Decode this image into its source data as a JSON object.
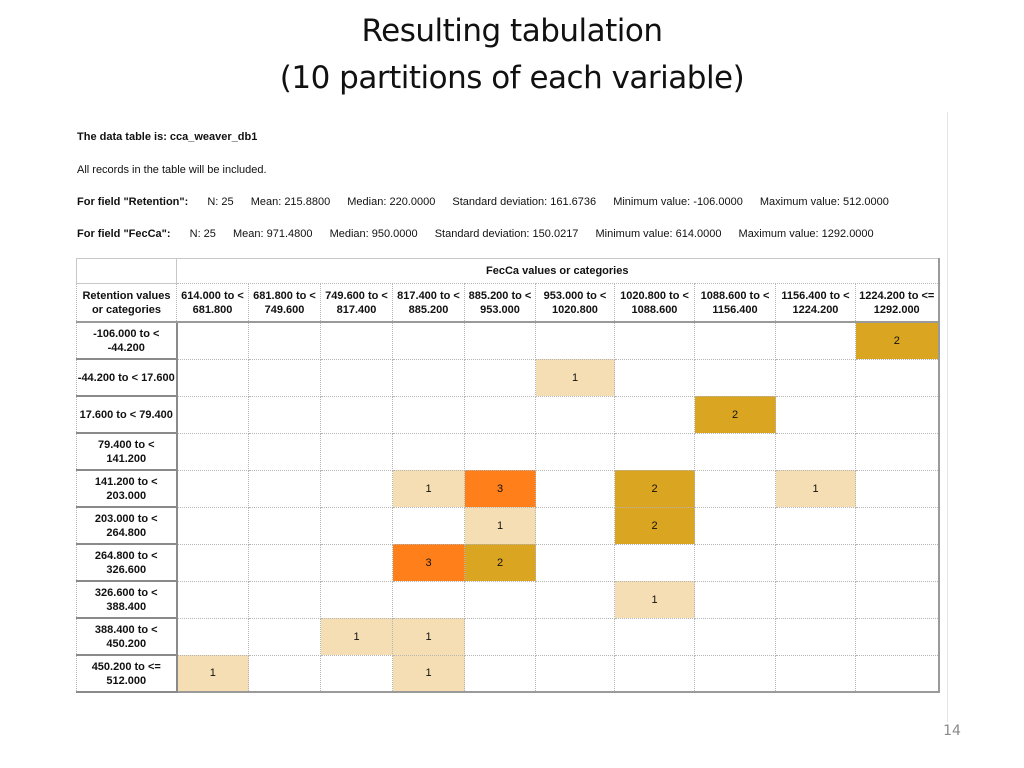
{
  "slide": {
    "title_line1": "Resulting tabulation",
    "title_line2": "(10 partitions of each variable)",
    "number": "14"
  },
  "report": {
    "data_table_line": "The data table is: cca_weaver_db1",
    "records_line": "All records in the table will be included.",
    "fields": [
      {
        "label": "For field \"Retention\":",
        "n": "N: 25",
        "mean": "Mean: 215.8800",
        "median": "Median: 220.0000",
        "sd": "Standard deviation: 161.6736",
        "min": "Minimum value: -106.0000",
        "max": "Maximum value: 512.0000"
      },
      {
        "label": "For field \"FecCa\":",
        "n": "N: 25",
        "mean": "Mean: 971.4800",
        "median": "Median: 950.0000",
        "sd": "Standard deviation: 150.0217",
        "min": "Minimum value: 614.0000",
        "max": "Maximum value: 1292.0000"
      }
    ]
  },
  "colors": {
    "count_1": "#f5deb3",
    "count_2": "#daa520",
    "count_3": "#ff7f1a"
  },
  "crosstab": {
    "column_group_label": "FecCa values or categories",
    "row_header_label": "Retention values or categories",
    "columns": [
      "614.000 to < 681.800",
      "681.800 to < 749.600",
      "749.600 to < 817.400",
      "817.400 to < 885.200",
      "885.200 to < 953.000",
      "953.000 to < 1020.800",
      "1020.800 to < 1088.600",
      "1088.600 to < 1156.400",
      "1156.400 to < 1224.200",
      "1224.200 to <= 1292.000"
    ],
    "rows": [
      {
        "label": "-106.000 to < -44.200",
        "counts": [
          null,
          null,
          null,
          null,
          null,
          null,
          null,
          null,
          null,
          2
        ]
      },
      {
        "label": "-44.200 to < 17.600",
        "counts": [
          null,
          null,
          null,
          null,
          null,
          1,
          null,
          null,
          null,
          null
        ]
      },
      {
        "label": "17.600 to < 79.400",
        "counts": [
          null,
          null,
          null,
          null,
          null,
          null,
          null,
          2,
          null,
          null
        ]
      },
      {
        "label": "79.400 to < 141.200",
        "counts": [
          null,
          null,
          null,
          null,
          null,
          null,
          null,
          null,
          null,
          null
        ]
      },
      {
        "label": "141.200 to < 203.000",
        "counts": [
          null,
          null,
          null,
          1,
          3,
          null,
          2,
          null,
          1,
          null
        ]
      },
      {
        "label": "203.000 to < 264.800",
        "counts": [
          null,
          null,
          null,
          null,
          1,
          null,
          2,
          null,
          null,
          null
        ]
      },
      {
        "label": "264.800 to < 326.600",
        "counts": [
          null,
          null,
          null,
          3,
          2,
          null,
          null,
          null,
          null,
          null
        ]
      },
      {
        "label": "326.600 to < 388.400",
        "counts": [
          null,
          null,
          null,
          null,
          null,
          null,
          1,
          null,
          null,
          null
        ]
      },
      {
        "label": "388.400 to < 450.200",
        "counts": [
          null,
          null,
          1,
          1,
          null,
          null,
          null,
          null,
          null,
          null
        ]
      },
      {
        "label": "450.200 to <= 512.000",
        "counts": [
          1,
          null,
          null,
          1,
          null,
          null,
          null,
          null,
          null,
          null
        ]
      }
    ]
  }
}
